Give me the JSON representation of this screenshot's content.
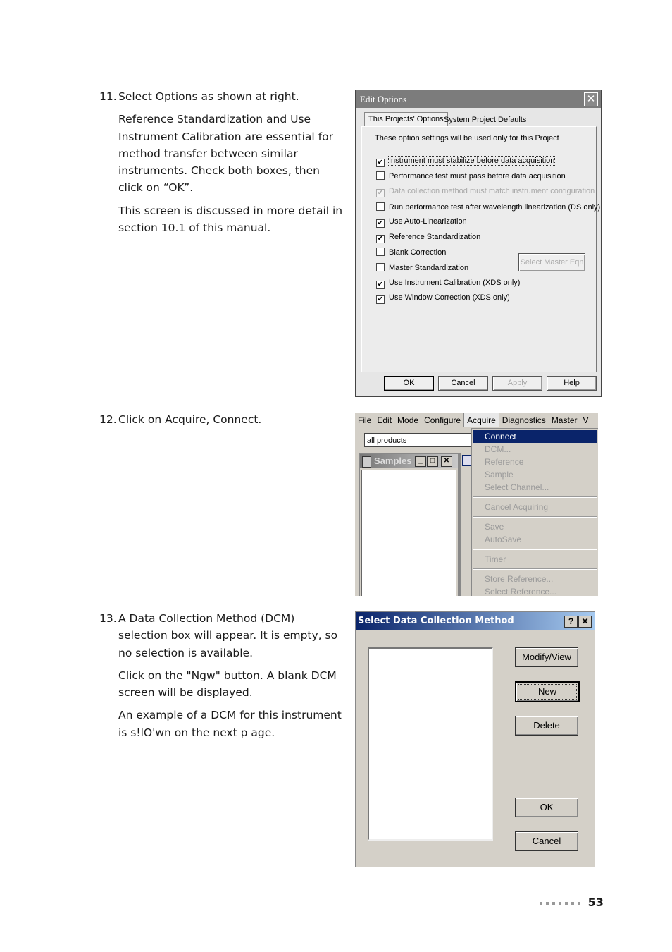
{
  "steps": [
    {
      "number": "11.",
      "paragraphs": [
        "Select Options as shown at right.",
        "Reference Standardization and Use Instrument Calibration are essential for method transfer between similar instruments. Check both boxes, then click on “OK”.",
        "This screen is discussed in more detail in section 10.1 of this manual."
      ]
    },
    {
      "number": "12.",
      "paragraphs": [
        "Click on Acquire, Connect."
      ]
    },
    {
      "number": "13.",
      "paragraphs": [
        "A Data Collection Method (DCM) selection box will appear. It is empty, so no selection is available.",
        "Click on the \"Ngw\" button. A blank DCM screen will be displayed.",
        "An example of a DCM for this instrument is s!lO'wn on the next p age."
      ]
    }
  ],
  "edit_options": {
    "title": "Edit Options",
    "tabs": [
      "This Projects' Options",
      "System Project Defaults"
    ],
    "description": "These option settings will be used only for this Project",
    "options": [
      {
        "label": "Instrument must stabilize before data acquisition",
        "checked": true,
        "disabled": false
      },
      {
        "label": "Performance test must pass before data acquisition",
        "checked": false,
        "disabled": false
      },
      {
        "label": "Data collection method must match instrument configuration",
        "checked": true,
        "disabled": true
      },
      {
        "label": "Run performance test after wavelength linearization (DS only)",
        "checked": false,
        "disabled": false
      },
      {
        "label": "Use Auto-Linearization",
        "checked": true,
        "disabled": false
      },
      {
        "label": "Reference Standardization",
        "checked": true,
        "disabled": false
      },
      {
        "label": "Blank Correction",
        "checked": false,
        "disabled": false
      },
      {
        "label": "Master Standardization",
        "checked": false,
        "disabled": false
      },
      {
        "label": "Use Instrument Calibration (XDS only)",
        "checked": true,
        "disabled": false
      },
      {
        "label": "Use Window Correction (XDS only)",
        "checked": true,
        "disabled": false
      }
    ],
    "select_master_eqn": "Select Master Eqn",
    "buttons": {
      "ok": "OK",
      "cancel": "Cancel",
      "apply": "Apply",
      "help": "Help"
    }
  },
  "acquire_menu": {
    "menubar": [
      "File",
      "Edit",
      "Mode",
      "Configure",
      "Acquire",
      "Diagnostics",
      "Master",
      "V"
    ],
    "combo_value": "all products",
    "samples_title": "Samples",
    "items": [
      "Connect",
      "DCM...",
      "Reference",
      "Sample",
      "Select Channel...",
      "Cancel Acquiring",
      "Save",
      "AutoSave",
      "Timer",
      "Store Reference...",
      "Select Reference..."
    ]
  },
  "dcm_dialog": {
    "title": "Select Data Collection Method",
    "help_button": "?",
    "close_button": "✕",
    "buttons": {
      "modify": "Modify/View",
      "new": "New",
      "delete": "Delete",
      "ok": "OK",
      "cancel": "Cancel"
    }
  },
  "page_number": "53",
  "icons": {
    "check": "✔",
    "close": "✕"
  }
}
